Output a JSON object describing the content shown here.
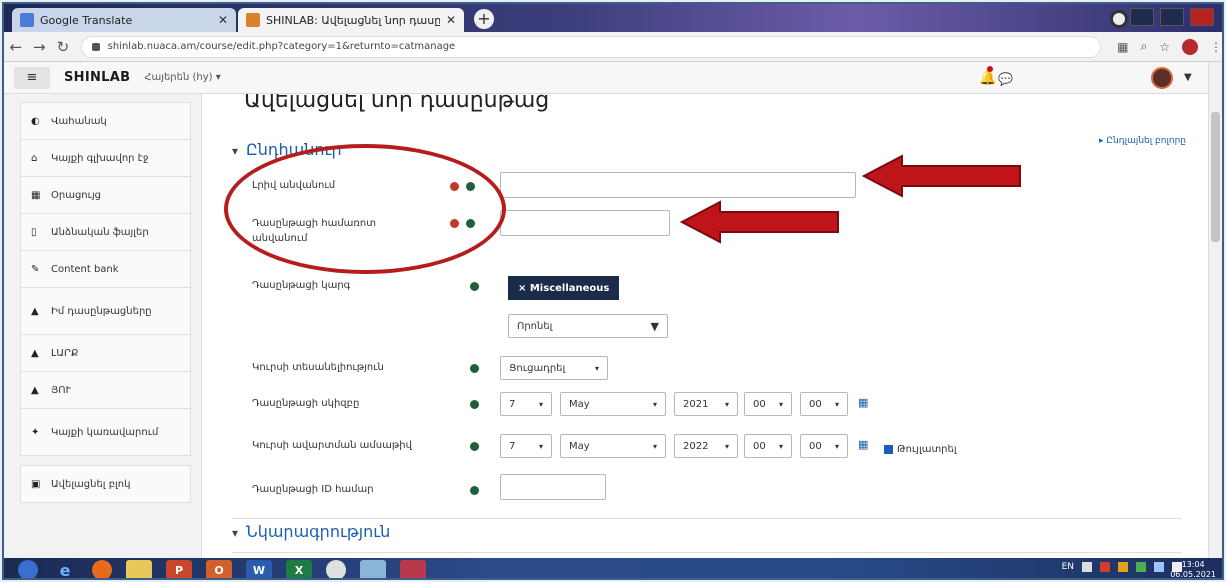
{
  "browser": {
    "tabs": [
      {
        "title": "Google Translate",
        "favicon_color": "#4a7bd8"
      },
      {
        "title": "SHINLAB: Ավելացնել նոր դասընթ...",
        "favicon_color": "#d9822b"
      }
    ],
    "url": "shinlab.nuaca.am/course/edit.php?category=1&returnto=catmanage"
  },
  "topnav": {
    "site_name": "SHINLAB",
    "language": "Հայերեն (hy) ▾"
  },
  "drawer": {
    "items": [
      {
        "label": "Վահանակ",
        "icon": "tachometer-icon"
      },
      {
        "label": "Կայքի գլխավոր էջ",
        "icon": "home-icon"
      },
      {
        "label": "Օրացույց",
        "icon": "calendar-icon"
      },
      {
        "label": "Անձնական ֆայլեր",
        "icon": "file-icon"
      },
      {
        "label": "Content bank",
        "icon": "pencil-icon"
      },
      {
        "label": "Իմ դասընթացները",
        "icon": "graduation-cap-icon"
      },
      {
        "label": "ԼԱՐՔ",
        "icon": "graduation-cap-icon"
      },
      {
        "label": "ՅՈՒ",
        "icon": "graduation-cap-icon"
      },
      {
        "label": "Կայքի կառավարում",
        "icon": "wrench-icon"
      },
      {
        "label": "Ավելացնել բլոկ",
        "icon": "plus-square-icon"
      }
    ]
  },
  "main": {
    "page_title": "Ավելացնել նոր դասընթաց",
    "collapse_all": "▸ Ընդլայնել բոլորը",
    "section_general": "Ընդհանուր",
    "section_description": "Նկարագրություն",
    "fields": {
      "fullname_label": "Լրիվ անվանում",
      "shortname_label": "Դասընթացի համառոտ անվանում",
      "category_label": "Դասընթացի կարգ",
      "category_value": "× Miscellaneous",
      "category_search": "Որոնել",
      "visibility_label": "Կուրսի տեսանելիություն",
      "visibility_value": "Ցուցադրել",
      "startdate_label": "Դասընթացի սկիզբը",
      "enddate_label": "Կուրսի ավարտման ամսաթիվ",
      "idnumber_label": "Դասընթացի ID համար",
      "enable_label": "Թույլատրել"
    },
    "start_date": {
      "day": "7",
      "month": "May",
      "year": "2021",
      "hour": "00",
      "minute": "00"
    },
    "end_date": {
      "day": "7",
      "month": "May",
      "year": "2022",
      "hour": "00",
      "minute": "00"
    }
  },
  "taskbar": {
    "tray_lang": "EN",
    "time": "13:04",
    "date": "06.05.2021"
  }
}
